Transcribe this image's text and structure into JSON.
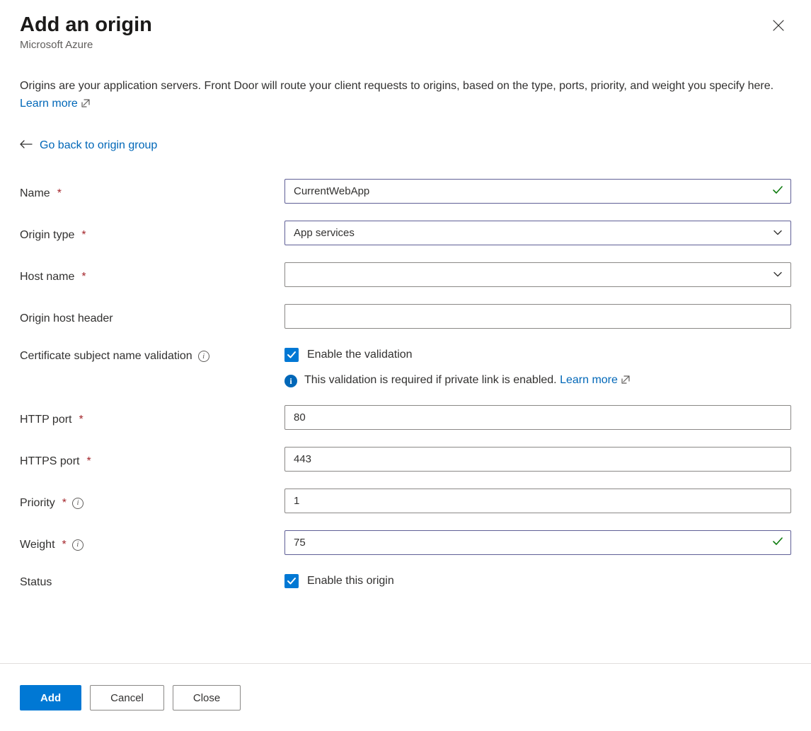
{
  "header": {
    "title": "Add an origin",
    "subtitle": "Microsoft Azure"
  },
  "description": {
    "text": "Origins are your application servers. Front Door will route your client requests to origins, based on the type, ports, priority, and weight you specify here. ",
    "learn_more": "Learn more"
  },
  "back_link": "Go back to origin group",
  "fields": {
    "name": {
      "label": "Name",
      "value": "CurrentWebApp"
    },
    "origin_type": {
      "label": "Origin type",
      "value": "App services"
    },
    "host_name": {
      "label": "Host name",
      "value": ""
    },
    "origin_host_header": {
      "label": "Origin host header",
      "value": ""
    },
    "cert_validation": {
      "label": "Certificate subject name validation",
      "checkbox_label": "Enable the validation",
      "checked": true,
      "info_text": "This validation is required if private link is enabled. ",
      "info_link": "Learn more"
    },
    "http_port": {
      "label": "HTTP port",
      "value": "80"
    },
    "https_port": {
      "label": "HTTPS port",
      "value": "443"
    },
    "priority": {
      "label": "Priority",
      "value": "1"
    },
    "weight": {
      "label": "Weight",
      "value": "75"
    },
    "status": {
      "label": "Status",
      "checkbox_label": "Enable this origin",
      "checked": true
    }
  },
  "footer": {
    "add": "Add",
    "cancel": "Cancel",
    "close": "Close"
  }
}
